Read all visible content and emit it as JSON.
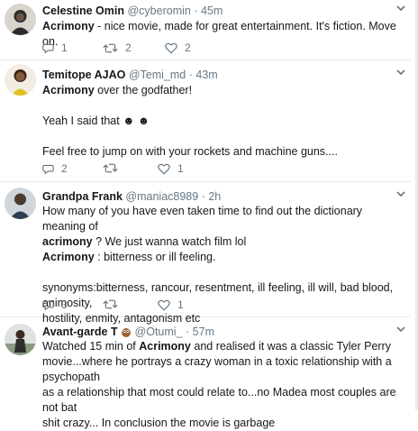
{
  "tweets": [
    {
      "name": "Celestine Omin",
      "handle": "@cyberomin",
      "time": "45m",
      "lines": [
        {
          "bold": "Acrimony",
          "text": " - nice movie, made for great entertainment. It's fiction. Move on."
        }
      ],
      "replies": "1",
      "retweets": "2",
      "likes": "2"
    },
    {
      "name": "Temitope AJAO",
      "handle": "@Temi_md",
      "time": "43m",
      "lines": [
        {
          "bold": "Acrimony",
          "text": " over the godfather!"
        },
        {
          "bold": "",
          "text": ""
        },
        {
          "bold": "",
          "text": "Yeah I said that ☻ ☻"
        },
        {
          "bold": "",
          "text": ""
        },
        {
          "bold": "",
          "text": "Feel free to jump on with your rockets and machine guns...."
        }
      ],
      "replies": "2",
      "retweets": "",
      "likes": "1"
    },
    {
      "name": "Grandpa Frank",
      "handle": "@maniac8989",
      "time": "2h",
      "line1": "How many of you have even taken time to find out the dictionary meaning of",
      "line2_bold": "acrimony",
      "line2_text": " ? We just wanna watch film lol",
      "line3_bold": "Acrimony",
      "line3_text": " : bitterness or ill feeling.",
      "line4": "synonyms:bitterness, rancour, resentment, ill feeling, ill will, bad blood, animosity,",
      "line5": "hostility, enmity, antagonism etc",
      "replies": "3",
      "retweets": "",
      "likes": "1"
    },
    {
      "name": "Avant-garde T",
      "handle": "@Otumi_",
      "time": "57m",
      "line1_text": "Watched 15 min of ",
      "line1_bold": "Acrimony",
      "line1_tail": " and realised it was a classic Tyler Perry",
      "line2": "movie...where he portrays a crazy woman in a toxic relationship with a psychopath",
      "line3": "as a relationship that most could relate to...no Madea most couples are not bat",
      "line4": "shit crazy... In conclusion the movie is garbage"
    }
  ],
  "icons": {
    "reply": "reply-icon",
    "retweet": "retweet-icon",
    "like": "heart-icon",
    "caret": "chevron-down-icon",
    "owl": "owl-emoji"
  },
  "colors": {
    "name": "#14171a",
    "meta": "#657786",
    "border": "#e6ecf0"
  }
}
